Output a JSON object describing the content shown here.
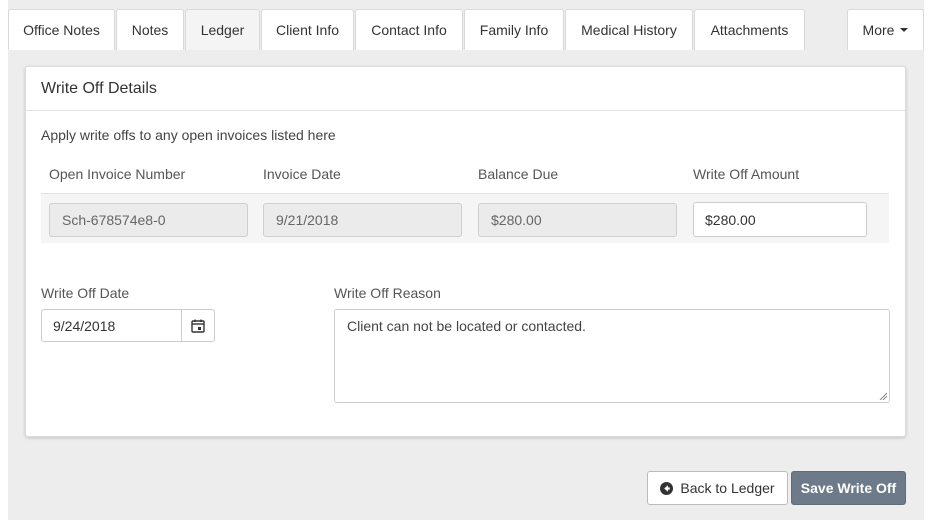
{
  "tabs": [
    {
      "label": "Office Notes",
      "active": false
    },
    {
      "label": "Notes",
      "active": false
    },
    {
      "label": "Ledger",
      "active": true
    },
    {
      "label": "Client Info",
      "active": false
    },
    {
      "label": "Contact Info",
      "active": false
    },
    {
      "label": "Family Info",
      "active": false
    },
    {
      "label": "Medical History",
      "active": false
    },
    {
      "label": "Attachments",
      "active": false
    }
  ],
  "more_tab": {
    "label": "More",
    "icon": "caret-down-icon"
  },
  "panel": {
    "title": "Write Off Details",
    "intro": "Apply write offs to any open invoices listed here"
  },
  "invoice_table": {
    "columns": [
      "Open Invoice Number",
      "Invoice Date",
      "Balance Due",
      "Write Off Amount"
    ],
    "rows": [
      {
        "invoice_number": "Sch-678574e8-0",
        "invoice_date": "9/21/2018",
        "balance_due": "$280.00",
        "write_off_amount": "$280.00"
      }
    ]
  },
  "write_off_date": {
    "label": "Write Off Date",
    "value": "9/24/2018",
    "icon": "calendar-icon"
  },
  "write_off_reason": {
    "label": "Write Off Reason",
    "value": "Client can not be located or contacted."
  },
  "actions": {
    "back_label": "Back to Ledger",
    "back_icon": "arrow-circle-left-icon",
    "save_label": "Save Write Off"
  },
  "colors": {
    "page_background": "#ededed",
    "save_button": "#6c7a89"
  }
}
